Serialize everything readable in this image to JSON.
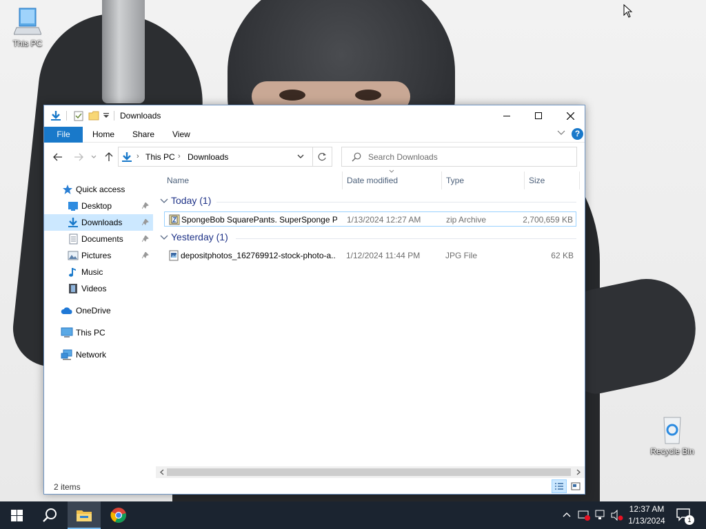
{
  "desktop": {
    "icons": [
      {
        "label": "This PC"
      },
      {
        "label": "Recycle Bin"
      }
    ]
  },
  "window": {
    "title": "Downloads",
    "ribbon": {
      "tabs": [
        "File",
        "Home",
        "Share",
        "View"
      ],
      "help": "?"
    },
    "address": {
      "crumbs": [
        "This PC",
        "Downloads"
      ]
    },
    "search": {
      "placeholder": "Search Downloads"
    },
    "nav_pane": {
      "items": [
        {
          "label": "Quick access",
          "icon": "star-icon"
        },
        {
          "label": "Desktop",
          "icon": "desktop-folder-icon",
          "pinned": true
        },
        {
          "label": "Downloads",
          "icon": "download-arrow-icon",
          "pinned": true,
          "selected": true
        },
        {
          "label": "Documents",
          "icon": "documents-icon",
          "pinned": true
        },
        {
          "label": "Pictures",
          "icon": "pictures-icon",
          "pinned": true
        },
        {
          "label": "Music",
          "icon": "music-note-icon"
        },
        {
          "label": "Videos",
          "icon": "video-film-icon"
        },
        {
          "label": "OneDrive",
          "icon": "cloud-icon"
        },
        {
          "label": "This PC",
          "icon": "computer-icon"
        },
        {
          "label": "Network",
          "icon": "network-icon"
        }
      ]
    },
    "columns": [
      "Name",
      "Date modified",
      "Type",
      "Size"
    ],
    "groups": [
      {
        "label": "Today (1)",
        "files": [
          {
            "name": "SpongeBob SquarePants. SuperSponge P...",
            "date": "1/13/2024 12:27 AM",
            "type": "zip Archive",
            "size": "2,700,659 KB",
            "icon": "zip-archive-icon",
            "selected": true
          }
        ]
      },
      {
        "label": "Yesterday (1)",
        "files": [
          {
            "name": "depositphotos_162769912-stock-photo-a...",
            "date": "1/12/2024 11:44 PM",
            "type": "JPG File",
            "size": "62 KB",
            "icon": "image-file-icon",
            "selected": false
          }
        ]
      }
    ],
    "status": "2 items"
  },
  "taskbar": {
    "clock_time": "12:37 AM",
    "clock_date": "1/13/2024",
    "notifications": "1",
    "accent": "#76b9ed"
  },
  "colors": {
    "file_tab": "#1979ca",
    "selection": "#cce8ff",
    "group_header": "#1e3287",
    "taskbar": "#1b2430"
  }
}
